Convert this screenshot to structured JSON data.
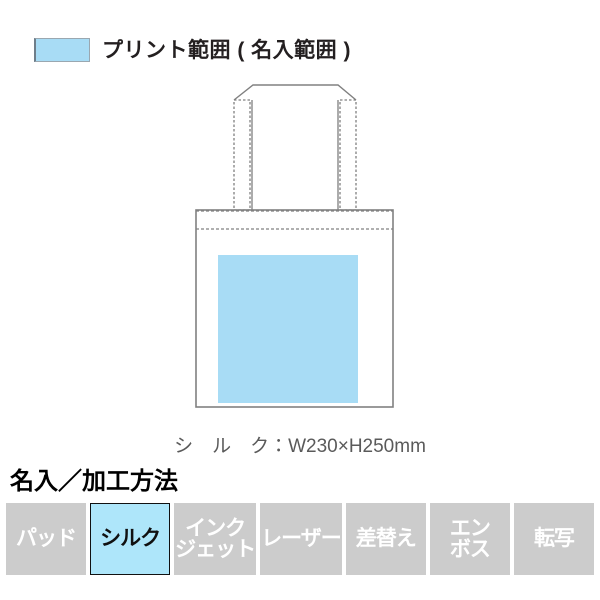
{
  "legend": {
    "swatch_icon": "print-area-swatch",
    "swatch_color": "#a8dcf5",
    "label": "プリント範囲 ( 名入範囲 )"
  },
  "illustration": {
    "name": "tote-bag-print-area-diagram",
    "print_area_color": "#a8dcf5",
    "outline_color": "#808080",
    "caption": "シ　ル　ク：W230×H250mm"
  },
  "section": {
    "heading": "名入／加工方法"
  },
  "methods": {
    "active_color": "#aee6fa",
    "inactive_color": "#cccccc",
    "items": [
      {
        "id": "pad",
        "lines": [
          "パッド"
        ],
        "active": false
      },
      {
        "id": "silk",
        "lines": [
          "シルク"
        ],
        "active": true
      },
      {
        "id": "inkjet",
        "lines": [
          "インク",
          "ジェット"
        ],
        "active": false
      },
      {
        "id": "laser",
        "lines": [
          "レーザー"
        ],
        "active": false
      },
      {
        "id": "sashikae",
        "lines": [
          "差替え"
        ],
        "active": false
      },
      {
        "id": "emboss",
        "lines": [
          "エン",
          "ボス"
        ],
        "active": false
      },
      {
        "id": "transfer",
        "lines": [
          "転写"
        ],
        "active": false
      }
    ]
  }
}
